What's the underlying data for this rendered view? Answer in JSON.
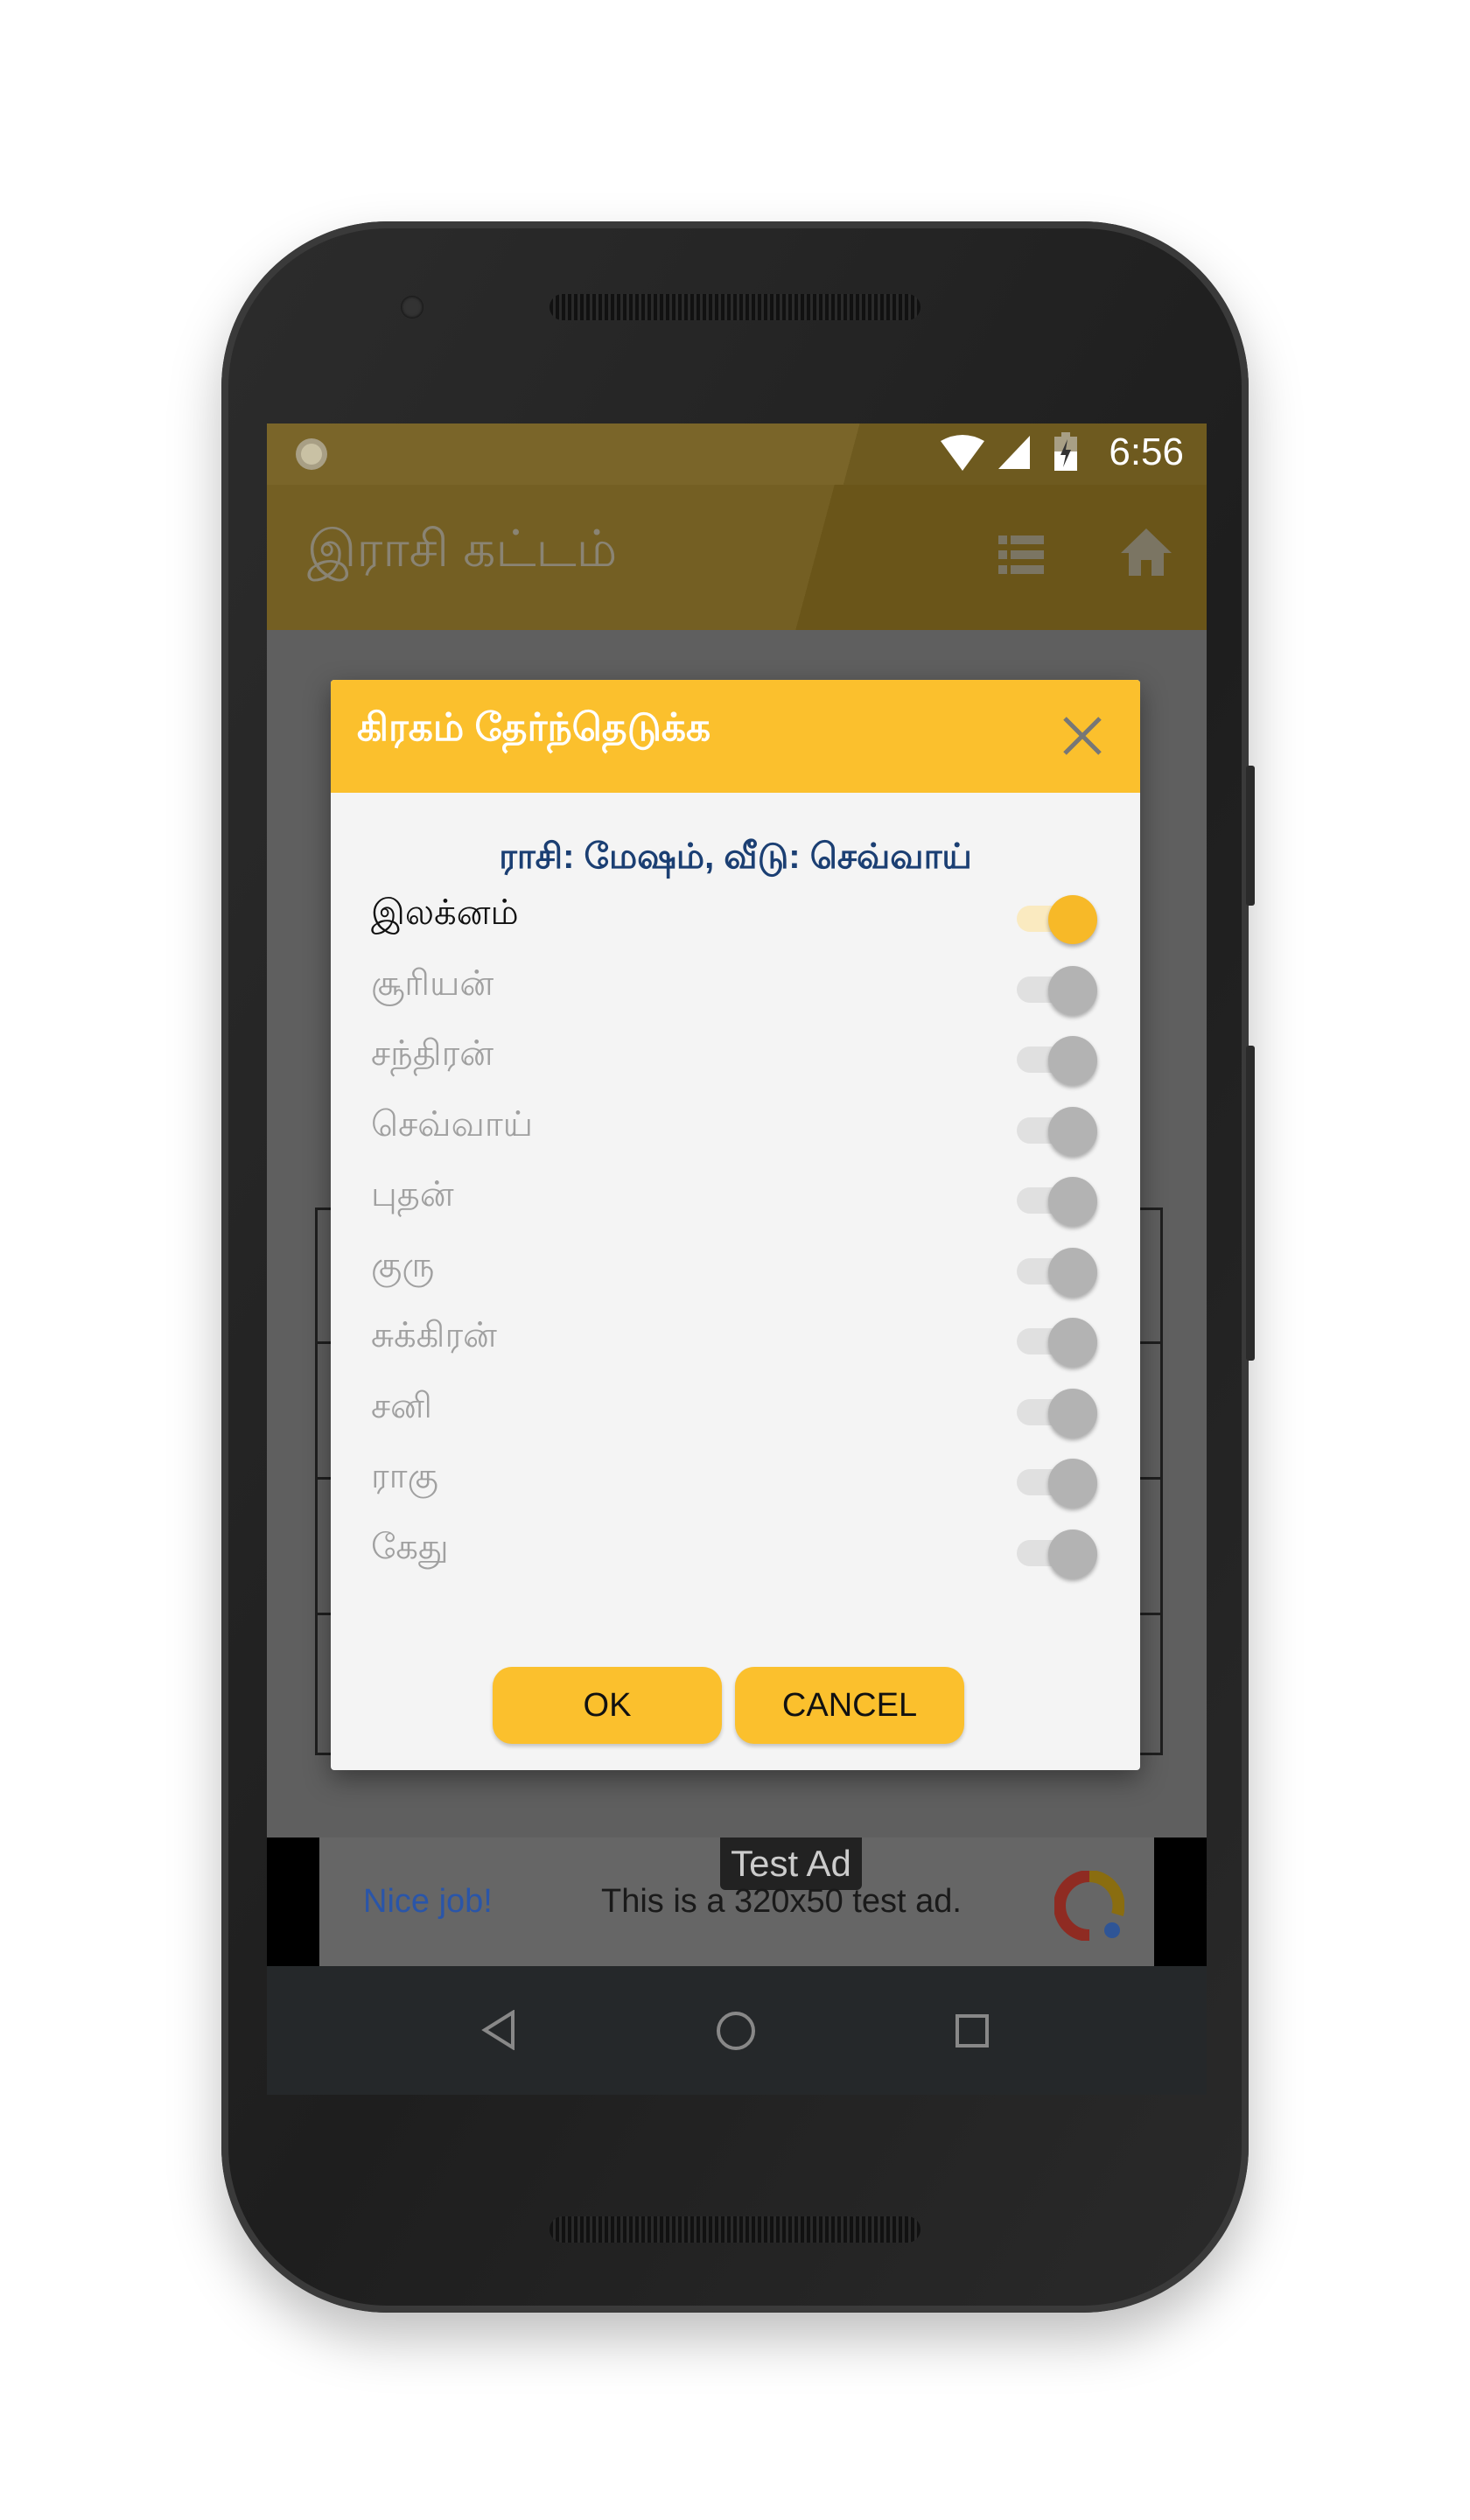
{
  "status_bar": {
    "time": "6:56",
    "icons": [
      "notification-circle-icon",
      "wifi-icon",
      "signal-icon",
      "battery-charging-icon"
    ]
  },
  "app_bar": {
    "title": "இராசி கட்டம்",
    "actions": [
      "list-icon",
      "home-icon"
    ]
  },
  "dialog": {
    "title": "கிரகம் தேர்ந்தெடுக்க",
    "subtitle": "ராசி: மேஷம், வீடு: செவ்வாய்",
    "items": [
      {
        "label": "இலக்னம்",
        "checked": true
      },
      {
        "label": "சூரியன்",
        "checked": false
      },
      {
        "label": "சந்திரன்",
        "checked": false
      },
      {
        "label": "செவ்வாய்",
        "checked": false
      },
      {
        "label": "புதன்",
        "checked": false
      },
      {
        "label": "குரு",
        "checked": false
      },
      {
        "label": "சுக்கிரன்",
        "checked": false
      },
      {
        "label": "சனி",
        "checked": false
      },
      {
        "label": "ராகு",
        "checked": false
      },
      {
        "label": "கேது",
        "checked": false
      }
    ],
    "ok_label": "OK",
    "cancel_label": "CANCEL"
  },
  "ad": {
    "tag": "Test Ad",
    "headline": "Nice job!",
    "body": "This is a 320x50 test ad."
  },
  "colors": {
    "accent": "#fbc02d",
    "subtitle": "#1b3f73",
    "toggle_on": "#f7b928"
  }
}
